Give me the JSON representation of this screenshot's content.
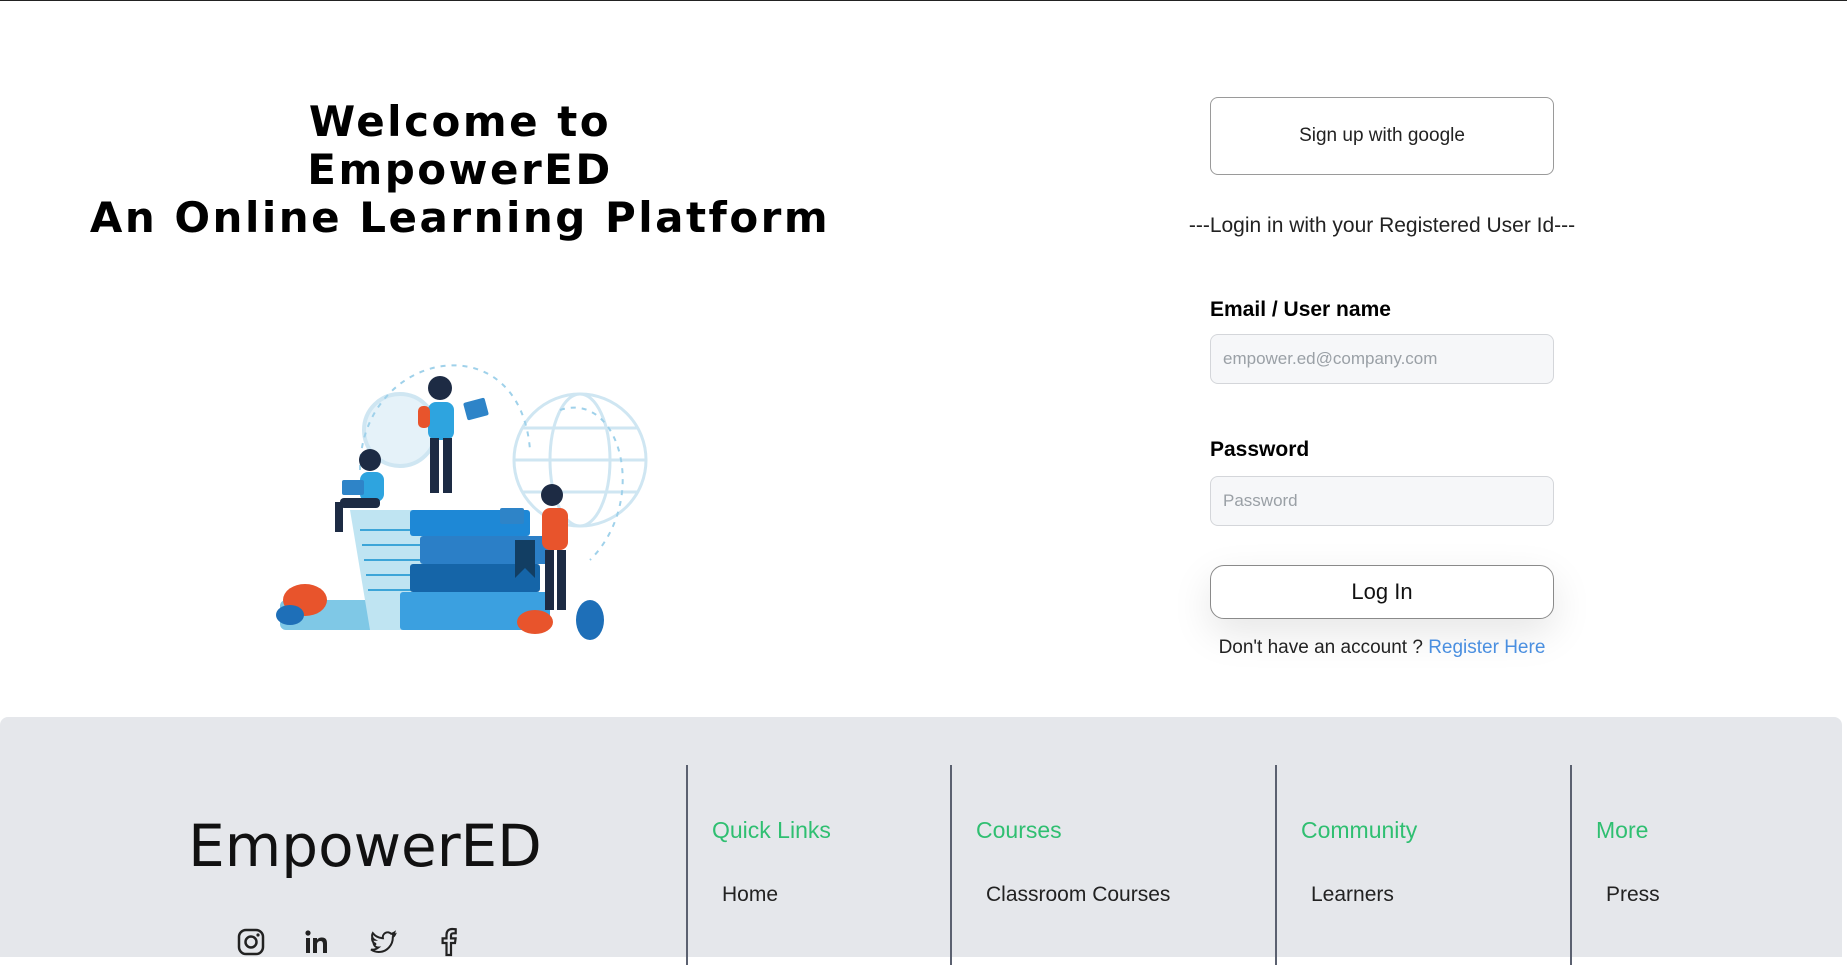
{
  "hero": {
    "line1": "Welcome to",
    "line2": "EmpowerED",
    "line3": "An Online Learning Platform"
  },
  "login": {
    "google_button": "Sign up with google",
    "divider": "---Login in with your Registered User Id---",
    "email_label": "Email / User name",
    "email_placeholder": "empower.ed@company.com",
    "password_label": "Password",
    "password_placeholder": "Password",
    "login_button": "Log In",
    "no_account_text": "Don't have an account ?",
    "register_link": "Register Here"
  },
  "footer": {
    "brand": "EmpowerED",
    "socials": [
      "instagram-icon",
      "linkedin-icon",
      "twitter-icon",
      "facebook-icon"
    ],
    "columns": [
      {
        "title": "Quick Links",
        "first_link": "Home"
      },
      {
        "title": "Courses",
        "first_link": "Classroom Courses"
      },
      {
        "title": "Community",
        "first_link": "Learners"
      },
      {
        "title": "More",
        "first_link": "Press"
      }
    ]
  },
  "colors": {
    "accent_green": "#2fbf71",
    "link_blue": "#4a8fe0",
    "footer_bg": "#e5e7eb"
  }
}
